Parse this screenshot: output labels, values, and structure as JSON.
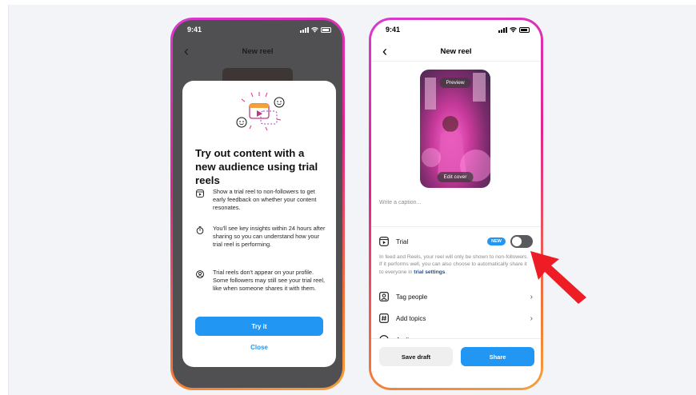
{
  "colors": {
    "accent": "#2196f3",
    "arrow": "#ee1c25",
    "frame_gradient": [
      "#d93ad0",
      "#e0248f",
      "#f0753a",
      "#f5a13a"
    ]
  },
  "phone1": {
    "time": "9:41",
    "nav_title": "New reel",
    "modal": {
      "title": "Try out content with a new audience using trial reels",
      "features": [
        {
          "icon": "reel-icon",
          "text": "Show a trial reel to non-followers to get early feedback on whether your content resonates."
        },
        {
          "icon": "timer-icon",
          "text": "You'll see key insights within 24 hours after sharing so you can understand how your trial reel is performing."
        },
        {
          "icon": "profile-icon",
          "text": "Trial reels don't appear on your profile. Some followers may still see your trial reel, like when someone shares it with them."
        }
      ],
      "primary_button": "Try it",
      "close_link": "Close"
    }
  },
  "phone2": {
    "time": "9:41",
    "nav_title": "New reel",
    "cover": {
      "preview_label": "Preview",
      "edit_cover_label": "Edit cover"
    },
    "caption_placeholder": "Write a caption...",
    "trial": {
      "label": "Trial",
      "badge": "NEW",
      "toggle_on": false,
      "description": "In feed and Reels, your reel will only be shown to non-followers. If it performs well, you can also choose to automatically share it to everyone in",
      "link": "trial settings",
      "description_end": "."
    },
    "rows": [
      {
        "icon": "tag-people-icon",
        "label": "Tag people"
      },
      {
        "icon": "hashtag-icon",
        "label": "Add topics"
      },
      {
        "icon": "audience-icon",
        "label": "Audience"
      }
    ],
    "buttons": {
      "save_draft": "Save draft",
      "share": "Share"
    }
  }
}
